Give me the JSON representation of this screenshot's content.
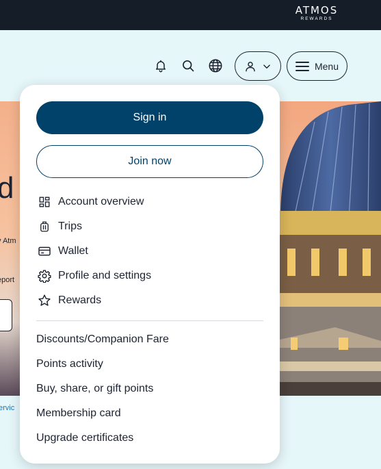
{
  "brand": {
    "name": "ATMOS",
    "sub": "REWARDS"
  },
  "header": {
    "menu_label": "Menu"
  },
  "background": {
    "big_text": "d c",
    "line1": "v Atm",
    "line2": "eport",
    "link": "ervic"
  },
  "panel": {
    "signin_label": "Sign in",
    "join_label": "Join now",
    "nav_items": [
      {
        "label": "Account overview",
        "icon": "dashboard-icon"
      },
      {
        "label": "Trips",
        "icon": "luggage-icon"
      },
      {
        "label": "Wallet",
        "icon": "wallet-icon"
      },
      {
        "label": "Profile and settings",
        "icon": "gear-icon"
      },
      {
        "label": "Rewards",
        "icon": "star-icon"
      }
    ],
    "links": [
      "Discounts/Companion Fare",
      "Points activity",
      "Buy, share, or gift points",
      "Membership card",
      "Upgrade certificates"
    ]
  },
  "colors": {
    "topbar": "#141d28",
    "page_bg": "#e6f7fa",
    "primary": "#01426a",
    "text": "#1d2330"
  }
}
